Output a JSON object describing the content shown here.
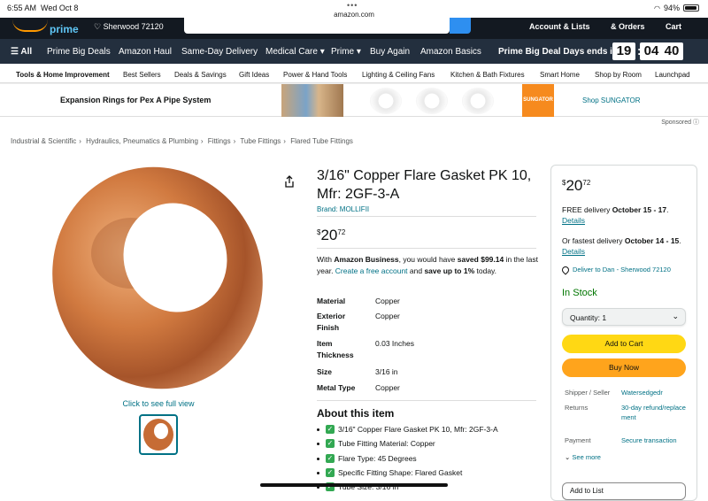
{
  "status": {
    "time": "6:55 AM",
    "date": "Wed Oct 8",
    "url": "amazon.com",
    "battery": "94%"
  },
  "navtop": {
    "prime": "prime",
    "location": "Sherwood 72120",
    "account": "Account & Lists",
    "orders": "& Orders",
    "cart": "Cart"
  },
  "nav": {
    "all": "All",
    "items": [
      "Prime Big Deals",
      "Amazon Haul",
      "Same-Day Delivery",
      "Medical Care",
      "Prime",
      "Buy Again",
      "Amazon Basics"
    ],
    "deal_label": "Prime Big Deal Days ends in",
    "timer": {
      "h": "19",
      "m": "04",
      "s": "40"
    }
  },
  "subnav": [
    "Tools & Home Improvement",
    "Best Sellers",
    "Deals & Savings",
    "Gift Ideas",
    "Power & Hand Tools",
    "Lighting & Ceiling Fans",
    "Kitchen & Bath Fixtures",
    "Smart Home",
    "Shop by Room",
    "Launchpad"
  ],
  "banner": {
    "title": "Expansion Rings for Pex A Pipe System",
    "brand": "SUNGATOR",
    "shop": "Shop SUNGATOR",
    "sponsored": "Sponsored"
  },
  "breadcrumb": [
    "Industrial & Scientific",
    "Hydraulics, Pneumatics & Plumbing",
    "Fittings",
    "Tube Fittings",
    "Flared Tube Fittings"
  ],
  "product": {
    "title": "3/16\" Copper Flare Gasket PK 10, Mfr: 2GF-3-A",
    "brand": "Brand: MOLLIFII",
    "price_whole": "20",
    "price_fraction": "72",
    "savings": {
      "pre": "With ",
      "program": "Amazon Business",
      "mid": ", you would have ",
      "saved": "saved $99.14",
      "mid2": " in the last year. ",
      "link": "Create a free account",
      "mid3": " and ",
      "save_pct": "save up to 1%",
      "post": " today."
    },
    "specs": [
      {
        "k": "Material",
        "v": "Copper"
      },
      {
        "k": "Exterior Finish",
        "v": "Copper"
      },
      {
        "k": "Item Thickness",
        "v": "0.03 Inches"
      },
      {
        "k": "Size",
        "v": "3/16 in"
      },
      {
        "k": "Metal Type",
        "v": "Copper"
      }
    ],
    "full_view": "Click to see full view",
    "about_title": "About this item",
    "bullets": [
      "3/16\" Copper Flare Gasket PK 10, Mfr: 2GF-3-A",
      "Tube Fitting Material: Copper",
      "Flare Type: 45 Degrees",
      "Specific Fitting Shape: Flared Gasket",
      "Tube Size: 3/16 in"
    ]
  },
  "buybox": {
    "price_whole": "20",
    "price_fraction": "72",
    "free_delivery_pre": "FREE delivery ",
    "free_delivery_date": "October 15 - 17",
    "details": "Details",
    "fastest_pre": "Or fastest delivery ",
    "fastest_date": "October 14 - 15",
    "deliver_to": "Deliver to Dan - Sherwood 72120",
    "stock": "In Stock",
    "quantity": "Quantity: 1",
    "add_to_cart": "Add to Cart",
    "buy_now": "Buy Now",
    "shipper_label": "Shipper / Seller",
    "shipper": "Watersedgedr",
    "returns_label": "Returns",
    "returns": "30-day refund/replacement",
    "payment_label": "Payment",
    "payment": "Secure transaction",
    "see_more": "See more",
    "add_to_list": "Add to List"
  },
  "colors": {
    "nav_dark": "#131921",
    "nav_main": "#232f3e",
    "link": "#007185",
    "cart": "#ffd814",
    "buy": "#ffa41c",
    "stock": "#007600",
    "copper": "#c46a34"
  }
}
